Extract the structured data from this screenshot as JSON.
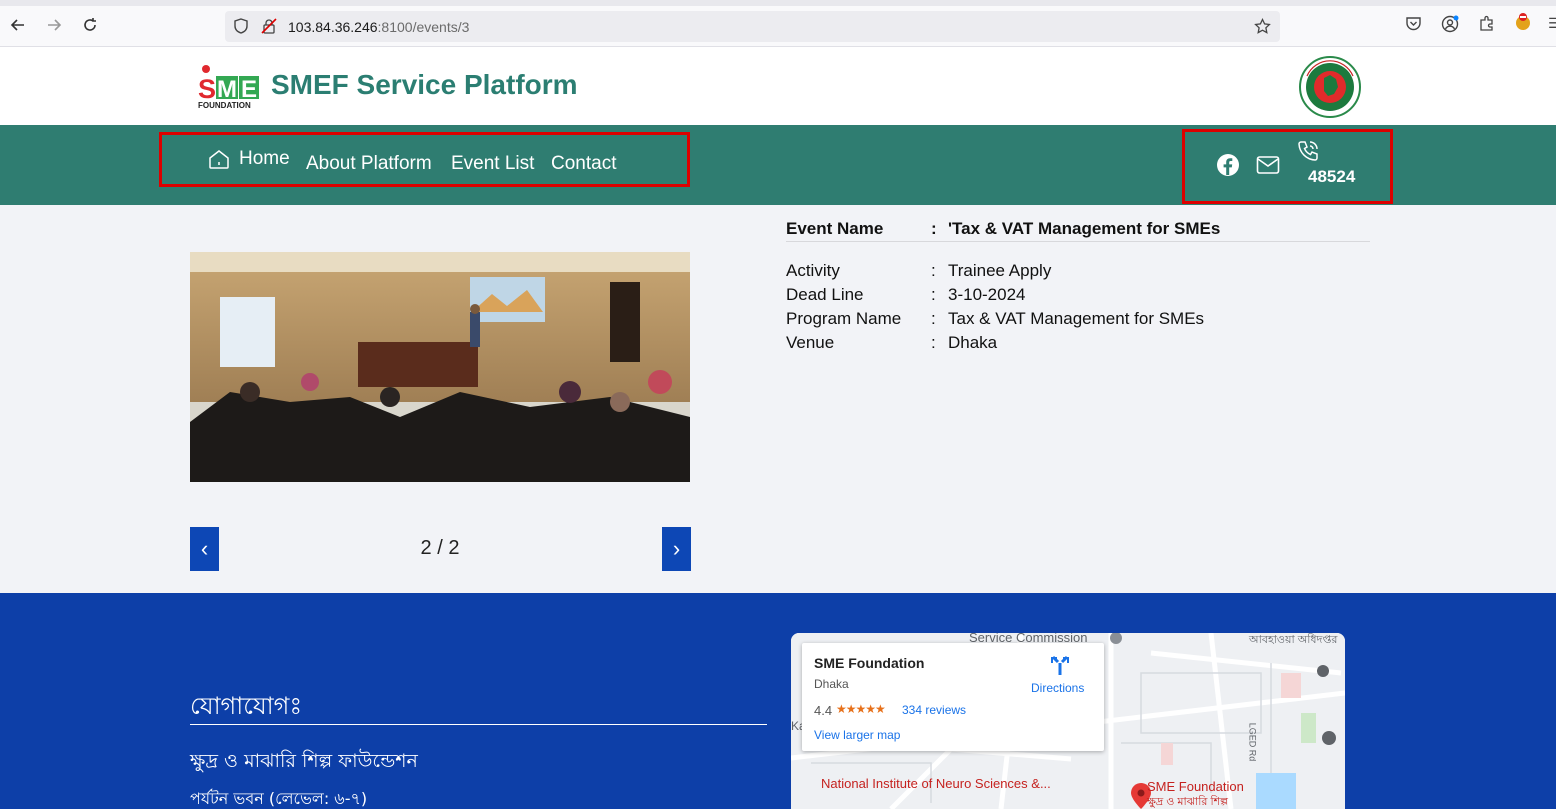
{
  "browser": {
    "url_host": "103.84.36.246",
    "url_rest": ":8100/events/3"
  },
  "header": {
    "logo_text": "SME",
    "logo_sub": "FOUNDATION",
    "title": "SMEF Service Platform"
  },
  "nav": {
    "items": [
      {
        "label": "Home"
      },
      {
        "label": "About Platform"
      },
      {
        "label": "Event List"
      },
      {
        "label": "Contact"
      }
    ],
    "phone": "48524"
  },
  "event": {
    "name_label": "Event Name",
    "name_value": "'Tax & VAT Management for SMEs",
    "rows": [
      {
        "label": "Activity",
        "value": "Trainee Apply"
      },
      {
        "label": "Dead Line",
        "value": "3-10-2024"
      },
      {
        "label": "Program Name",
        "value": "Tax & VAT Management for SMEs"
      },
      {
        "label": "Venue",
        "value": "Dhaka"
      }
    ],
    "separator": ":"
  },
  "slider": {
    "prev": "‹",
    "next": "›",
    "counter": "2 / 2"
  },
  "footer": {
    "heading": "যোগাযোগঃ",
    "org": "ক্ষুদ্র ও মাঝারি শিল্প ফাউন্ডেশন",
    "address": "পর্যটন ভবন (লেভেল: ৬-৭)"
  },
  "map": {
    "place_name": "SME Foundation",
    "city": "Dhaka",
    "rating": "4.4",
    "stars": "★★★★★",
    "reviews": "334 reviews",
    "larger_map": "View larger map",
    "directions": "Directions",
    "label_commission": "Service Commission",
    "label_neuro": "National Institute of Neuro Sciences &...",
    "label_pin": "SME Foundation",
    "label_pin_sub": "ক্ষুদ্র ও মাঝারি শিল্প",
    "label_road": "LGED Rd",
    "label_weather": "আবহাওয়া অধিদপ্তর",
    "label_left": "Ka...oroni"
  },
  "colors": {
    "nav_bg": "#2f7d71",
    "title": "#2b7e72",
    "footer_bg": "#0d3fa8",
    "highlight": "#dd0000"
  }
}
